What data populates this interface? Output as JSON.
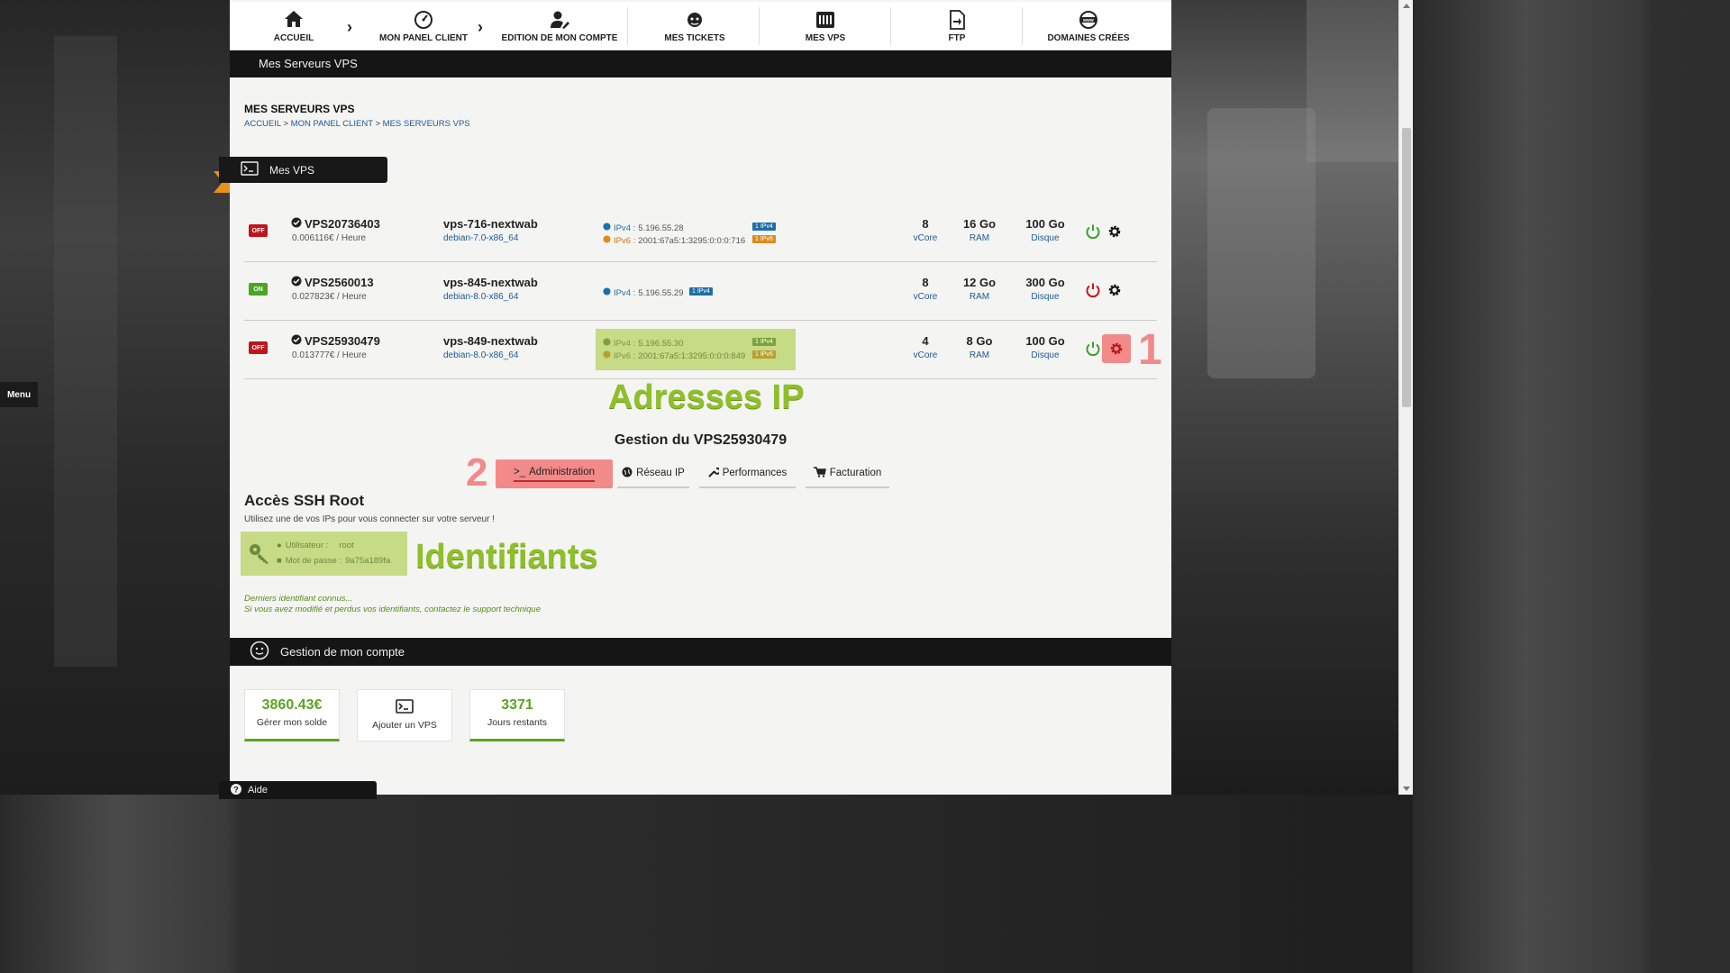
{
  "sidebar_toggle": {
    "label": "Menu"
  },
  "nav": {
    "items": [
      {
        "label": "ACCUEIL",
        "icon": "home-icon"
      },
      {
        "label": "MON PANEL CLIENT",
        "icon": "dashboard-icon"
      },
      {
        "label": "EDITION DE MON COMPTE",
        "icon": "user-edit-icon"
      },
      {
        "label": "MES TICKETS",
        "icon": "support-icon"
      },
      {
        "label": "MES VPS",
        "icon": "server-icon"
      },
      {
        "label": "FTP",
        "icon": "file-transfer-icon"
      },
      {
        "label": "DOMAINES CRÉES",
        "icon": "www-globe-icon"
      }
    ]
  },
  "titlebar": {
    "label": "Mes Serveurs VPS"
  },
  "page": {
    "title": "MES SERVEURS VPS",
    "breadcrumb": [
      "ACCUEIL",
      "MON PANEL CLIENT",
      "MES SERVEURS VPS"
    ],
    "breadcrumb_sep": ">"
  },
  "vps_section": {
    "label": "Mes VPS"
  },
  "vps": [
    {
      "status": "OFF",
      "id": "VPS20736403",
      "price": "0.006116€ / Heure",
      "name": "vps-716-nextwab",
      "os": "debian-7.0-x86_64",
      "ipv4_label": "IPv4 :",
      "ipv4": "5.196.55.28",
      "ipv4_tag": "1 IPv4",
      "ipv6_label": "IPv6 :",
      "ipv6": "2001:67a5:1:3295:0:0:0:716",
      "ipv6_tag": "1 IPv6",
      "vcore": "8",
      "vcore_unit": "vCore",
      "ram": "16 Go",
      "ram_unit": "RAM",
      "disk": "100 Go",
      "disk_unit": "Disque"
    },
    {
      "status": "ON",
      "id": "VPS2560013",
      "price": "0.027823€ / Heure",
      "name": "vps-845-nextwab",
      "os": "debian-8.0-x86_64",
      "ipv4_label": "IPv4 :",
      "ipv4": "5.196.55.29",
      "ipv4_tag": "1 IPv4",
      "vcore": "8",
      "vcore_unit": "vCore",
      "ram": "12 Go",
      "ram_unit": "RAM",
      "disk": "300 Go",
      "disk_unit": "Disque"
    },
    {
      "status": "OFF",
      "id": "VPS25930479",
      "price": "0.013777€ / Heure",
      "name": "vps-849-nextwab",
      "os": "debian-8.0-x86_64",
      "ipv4_label": "IPv4 :",
      "ipv4": "5.196.55.30",
      "ipv4_tag": "1 IPv4",
      "ipv6_label": "IPv6 :",
      "ipv6": "2001:67a5:1:3295:0:0:0:849",
      "ipv6_tag": "1 IPv6",
      "vcore": "4",
      "vcore_unit": "vCore",
      "ram": "8 Go",
      "ram_unit": "RAM",
      "disk": "100 Go",
      "disk_unit": "Disque"
    }
  ],
  "annotations": {
    "step1": "1",
    "step2": "2",
    "ip_label": "Adresses IP",
    "creds_label": "Identifiants"
  },
  "gestion": {
    "title": "Gestion du VPS25930479",
    "tabs": [
      {
        "label": "Administration",
        "icon": "terminal-icon",
        "active": true
      },
      {
        "label": "Réseau IP",
        "icon": "globe-icon",
        "active": false
      },
      {
        "label": "Performances",
        "icon": "wrench-icon",
        "active": false
      },
      {
        "label": "Facturation",
        "icon": "cart-icon",
        "active": false
      }
    ]
  },
  "ssh": {
    "title": "Accès SSH Root",
    "subtitle": "Utilisez une de vos IPs pour vous connecter sur votre serveur !",
    "user_label": "Utilisateur :",
    "user_value": "root",
    "password_label": "Mot de passe :",
    "password_value": "9a75a189fa",
    "note1": "Derniers identifiant connus...",
    "note2": "Si vous avez modifié et perdus vos identifiants, contactez le support technique"
  },
  "account": {
    "title": "Gestion de mon compte",
    "cards": [
      {
        "value": "3860.43€",
        "label": "Gérer mon solde"
      },
      {
        "label": "Ajouter un VPS"
      },
      {
        "value": "3371",
        "label": "Jours restants"
      }
    ]
  },
  "help": {
    "label": "Aide"
  },
  "colors": {
    "accent_green": "#8fbf2a",
    "highlight_green": "#c7da86",
    "highlight_red": "#f28a8a",
    "status_off": "#c0161b",
    "status_on": "#4aa520",
    "link_blue": "#1d5a94"
  }
}
